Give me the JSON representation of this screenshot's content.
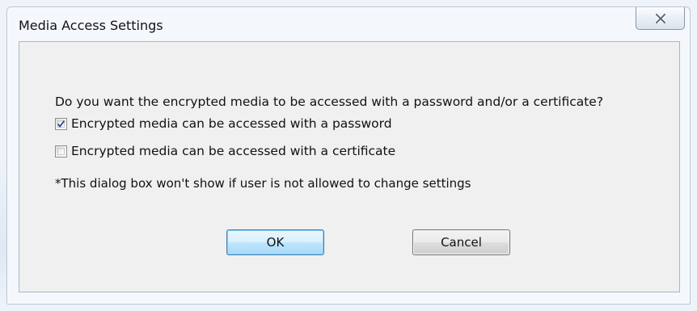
{
  "window": {
    "title": "Media Access Settings"
  },
  "dialog": {
    "question": "Do you want the encrypted media to be accessed with a password and/or a certificate?",
    "options": [
      {
        "label": "Encrypted media can be accessed with a password",
        "checked": true
      },
      {
        "label": "Encrypted media can be accessed with a certificate",
        "checked": false
      }
    ],
    "note": "*This dialog box won't show if user is not allowed to change settings"
  },
  "buttons": {
    "ok_label": "OK",
    "cancel_label": "Cancel"
  },
  "icons": {
    "close": "close-icon",
    "check": "checkmark-icon"
  },
  "colors": {
    "ok_border": "#3c7fb1",
    "check_mark": "#2d4a8c"
  }
}
